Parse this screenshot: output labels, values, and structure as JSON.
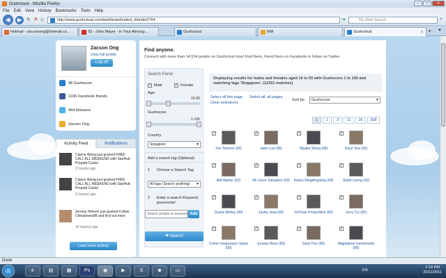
{
  "window": {
    "title": "Gushcloud - Mozilla Firefox"
  },
  "menu": [
    "File",
    "Edit",
    "View",
    "History",
    "Bookmarks",
    "Tools",
    "Help"
  ],
  "nav": {
    "url": "http://www.gushcloud.com/dashboard/select_friends/2764",
    "search_placeholder": "My Web Search"
  },
  "tabs": [
    {
      "label": "Hotmail - zacsonong@hotmail.co...",
      "icon": "hotmail-icon",
      "color": "#e06a2b"
    },
    {
      "label": "03 - John Mayer - In Your Atmosp...",
      "icon": "youtube-icon",
      "color": "#cc2b2b"
    },
    {
      "label": "Gushcloud",
      "icon": "gushcloud-icon",
      "color": "#2a7fc9"
    },
    {
      "label": "MM",
      "icon": "mm-icon",
      "color": "#e6a82a"
    },
    {
      "label": "Gushcloud",
      "icon": "gushcloud-icon",
      "color": "#2a7fc9"
    }
  ],
  "profile": {
    "name": "Zacson Ong",
    "view_profile": "View full profile",
    "logoff": "Log off",
    "stats": [
      {
        "icon": "gushscore-icon",
        "text": "48 Gushscore",
        "color": "#2a7fc9"
      },
      {
        "icon": "facebook-icon",
        "text": "1336 Facebook friends",
        "color": "#3b5998"
      },
      {
        "icon": "twitter-icon",
        "text": "464 followers",
        "color": "#4ab3e6"
      },
      {
        "icon": "star-icon",
        "text": "Zacson Ong",
        "color": "#e6b12a"
      }
    ]
  },
  "feed": {
    "tabs": [
      "Activity Feed",
      "Notifications"
    ],
    "items": [
      {
        "text": "Clarice Wong just gushed FREE CALL ALL WEEKEND with StarHub Prepaid Cards!",
        "time": "2 hour(s) ago"
      },
      {
        "text": "Clarice Wong just gushed FREE CALL ALL WEEKEND with StarHub Prepaid Cards!",
        "time": "2 hour(s) ago"
      },
      {
        "text": "Jeremy Heliven just gushed Follow Chinatowns88 and find out more",
        "time": "10 hour(s) ago"
      }
    ],
    "load_more": "Load more activity"
  },
  "main": {
    "heading": "Find anyone.",
    "subheading": "Connect with more than 14,534 people on Gushcloud now! Find them, friend them on Facebook or follow on Twitter.",
    "panel": {
      "title": "Search Panel",
      "male": "Male",
      "female": "Female",
      "age_label": "Age",
      "age_range": "10-50",
      "gush_label": "Gushscore",
      "gush_range": "1-100",
      "country_label": "Country",
      "country_value": "Singapore",
      "tag_title": "Add a search tag (Optional)",
      "step1": "Choose a Search Tag",
      "tag_select": "All tags (Search anything)",
      "step2": "Enter a search Keyword, press'enter'",
      "keyword_placeholder": "Search people or keywords",
      "add": "Add",
      "search": "Search"
    },
    "results": "Displaying results for males and females aged 10 to 50 with Gushscore 1 to 100 and matching tags 'Singapore'. (12301 matches)",
    "select_page": "Select all this page",
    "select_all": "Select all, all pages",
    "clear": "Clear selections",
    "sort_label": "Sort by:",
    "sort_value": "Gushscore",
    "pages": [
      "1",
      "2",
      "3",
      "11",
      "26",
      "308"
    ],
    "people": [
      [
        "Yeo Terence (96)",
        "Jade Low (96)",
        "Miyake Wong (96)",
        "Daryl Yow (93)"
      ],
      [
        "Afiil Barker (93)",
        "Ah Joyce Salvatore (93)",
        "Kenny Ringdingdong (93)",
        "Smith Leong (92)"
      ],
      [
        "Duane Melius (90)",
        "Jayley Jiaqi (90)",
        "XinYuan PotatoStick (90)",
        "Jerry Cyi (90)"
      ],
      [
        "Celine Vespasiano Sykes (89)",
        "Junxian Boon (89)",
        "Daryl Pan (89)",
        "Magdalene Germanotta (89)"
      ]
    ]
  },
  "status": "Done",
  "taskbar": {
    "lang": "EN",
    "time": "2:19 PM",
    "date": "20/11/2011"
  }
}
